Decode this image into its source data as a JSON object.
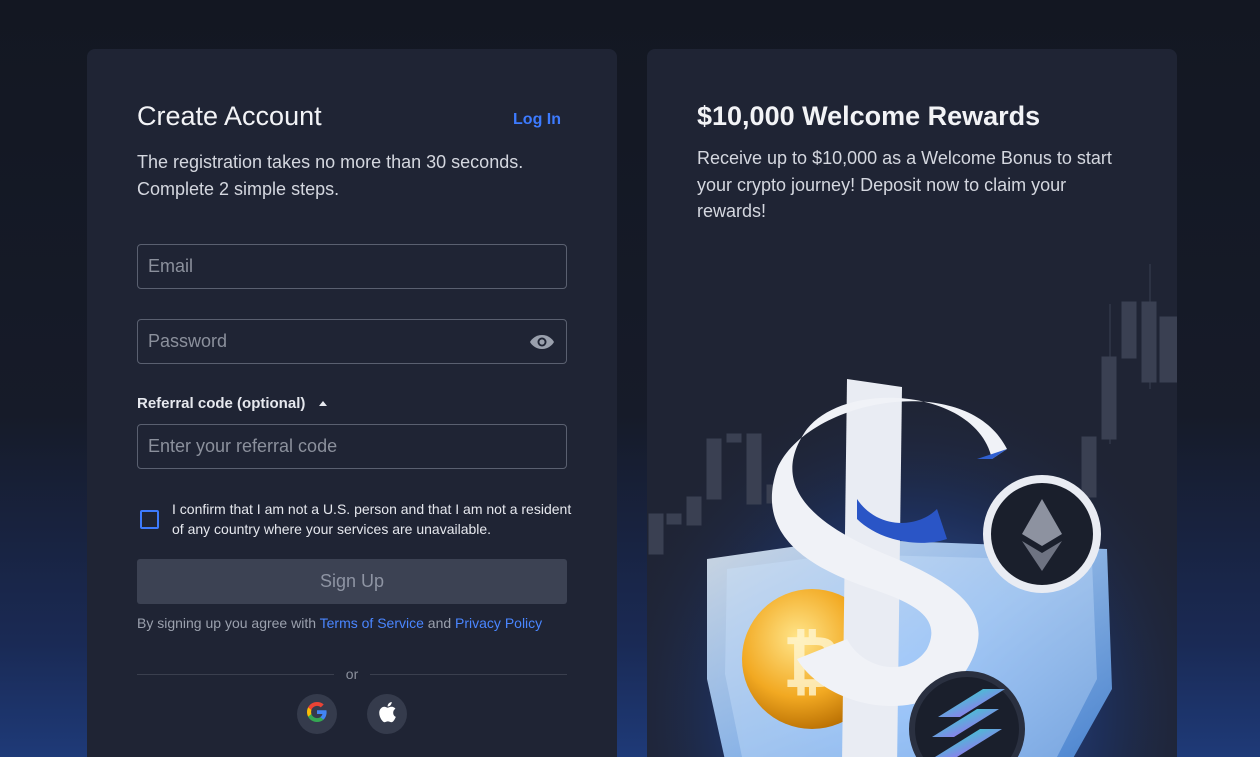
{
  "signup": {
    "title": "Create Account",
    "login_link": "Log In",
    "subtitle": "The registration takes no more than 30 seconds. Complete 2 simple steps.",
    "email_placeholder": "Email",
    "password_placeholder": "Password",
    "referral_label": "Referral code (optional)",
    "referral_placeholder": "Enter your referral code",
    "confirm_text": "I confirm that I am not a U.S. person and that I am not a resident of any country where your services are unavailable.",
    "signup_button": "Sign Up",
    "terms_prefix": "By signing up you agree with",
    "terms_link": "Terms of Service",
    "terms_and": "and",
    "privacy_link": "Privacy Policy",
    "divider_text": "or"
  },
  "rewards": {
    "title": "$10,000 Welcome Rewards",
    "text": "Receive up to $10,000 as a Welcome Bonus to start your crypto journey! Deposit now to claim your rewards!"
  },
  "colors": {
    "accent": "#3d7bff",
    "card_bg": "#1f2434",
    "button_disabled": "#3c4253"
  },
  "icons": [
    "eye-icon",
    "caret-up-icon",
    "google-icon",
    "apple-icon"
  ]
}
